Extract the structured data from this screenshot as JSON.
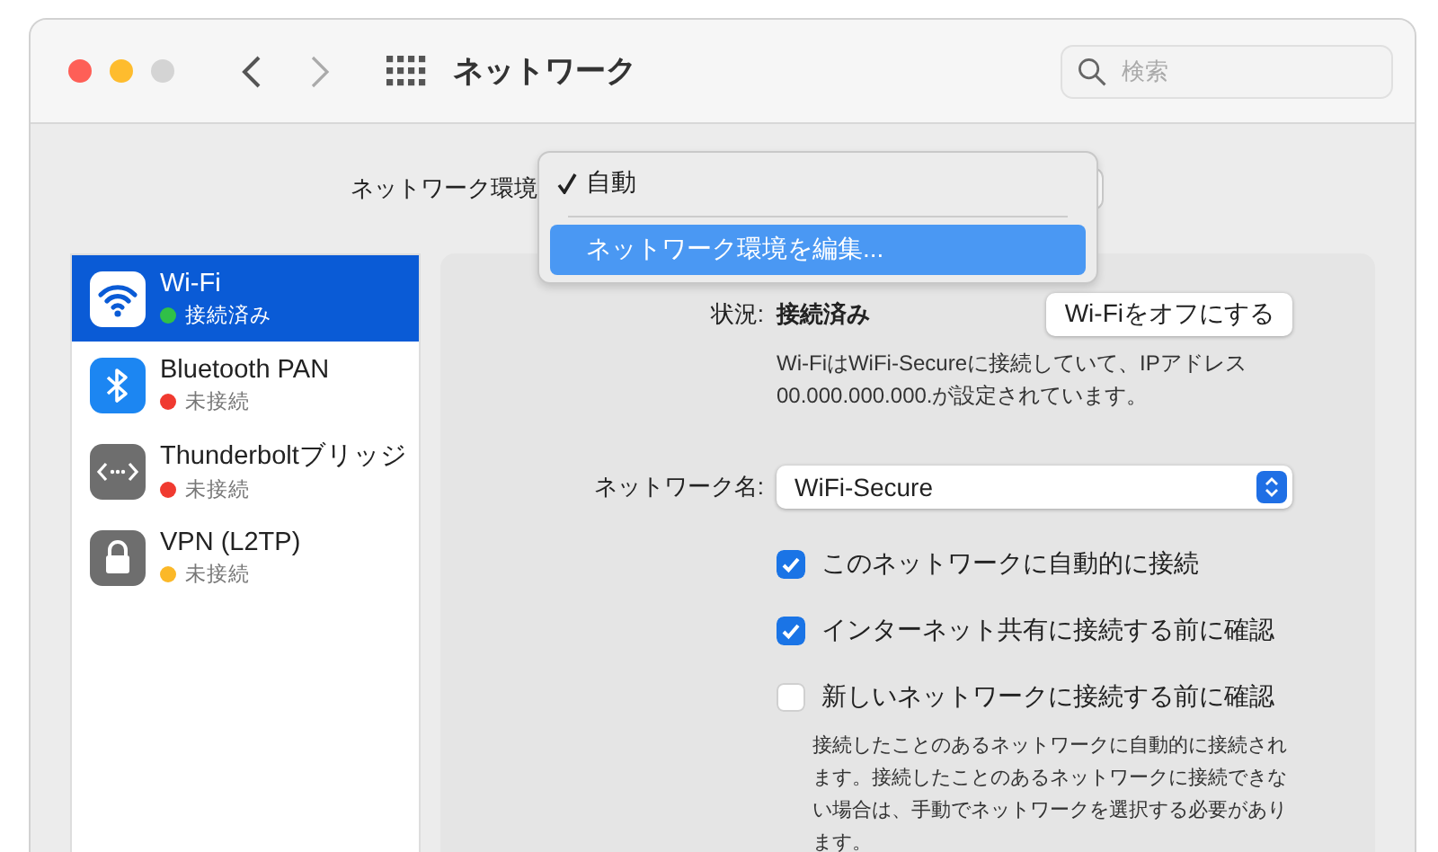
{
  "window": {
    "title": "ネットワーク"
  },
  "search": {
    "placeholder": "検索"
  },
  "location": {
    "label": "ネットワーク環境",
    "menu": [
      {
        "label": "自動",
        "checked": true,
        "selected": false
      },
      {
        "label": "ネットワーク環境を編集...",
        "checked": false,
        "selected": true
      }
    ]
  },
  "sidebar": {
    "items": [
      {
        "kind": "wifi",
        "name": "Wi-Fi",
        "status": "接続済み",
        "color": "#30c048",
        "selected": true
      },
      {
        "kind": "bluetooth",
        "name": "Bluetooth PAN",
        "status": "未接続",
        "color": "#f03a30",
        "selected": false
      },
      {
        "kind": "thunderbolt",
        "name": "Thunderboltブリッジ",
        "status": "未接続",
        "color": "#f03a30",
        "selected": false
      },
      {
        "kind": "vpn",
        "name": "VPN (L2TP)",
        "status": "未接続",
        "color": "#fbb828",
        "selected": false
      }
    ]
  },
  "detail": {
    "status_label": "状況:",
    "status_value": "接続済み",
    "toggle_button": "Wi-Fiをオフにする",
    "status_description": "Wi-FiはWiFi-Secureに接続していて、IPアドレス00.000.000.000.が設定されています。",
    "network_name_label": "ネットワーク名:",
    "network_name_value": "WiFi-Secure",
    "options": [
      {
        "label": "このネットワークに自動的に接続",
        "checked": true
      },
      {
        "label": "インターネット共有に接続する前に確認",
        "checked": true
      },
      {
        "label": "新しいネットワークに接続する前に確認",
        "checked": false
      }
    ],
    "note": "接続したことのあるネットワークに自動的に接続されます。接続したことのあるネットワークに接続できない場合は、手動でネットワークを選択する必要があります。"
  }
}
